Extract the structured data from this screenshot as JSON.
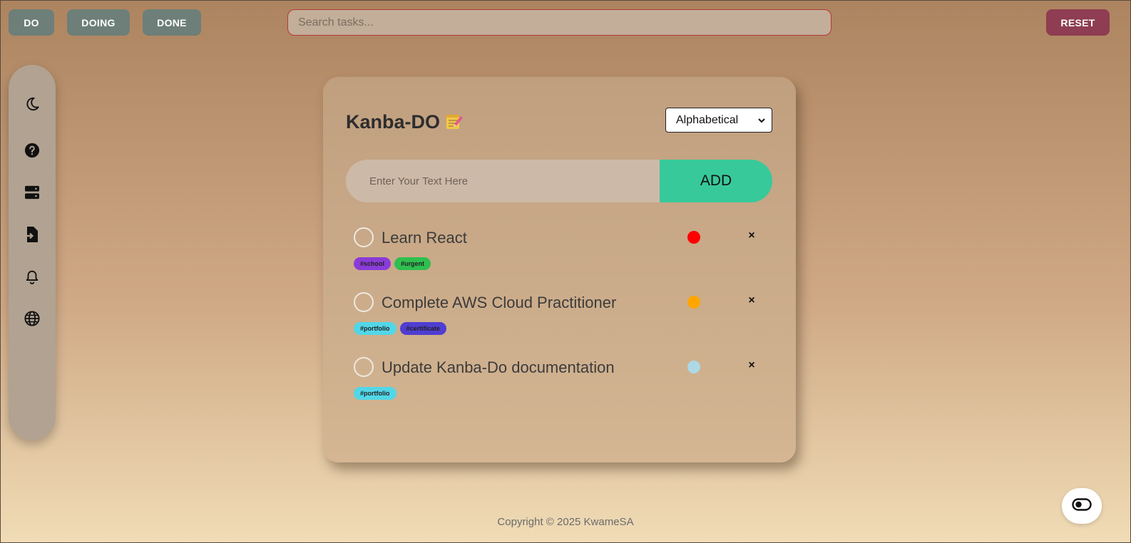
{
  "nav": {
    "do_label": "DO",
    "doing_label": "DOING",
    "done_label": "DONE",
    "reset_label": "RESET"
  },
  "search": {
    "placeholder": "Search tasks..."
  },
  "sidebar": {
    "icons": [
      "moon-icon",
      "help-icon",
      "server-icon",
      "import-icon",
      "bell-icon",
      "globe-icon"
    ]
  },
  "card": {
    "title": "Kanba-DO",
    "sort": {
      "selected": "Alphabetical"
    },
    "entry": {
      "placeholder": "Enter Your Text Here",
      "add_label": "ADD"
    },
    "tasks": [
      {
        "text": "Learn React",
        "priority_color": "#ff0000",
        "delete_label": "×",
        "tags": [
          {
            "label": "#school",
            "color": "#8a3bd8"
          },
          {
            "label": "#urgent",
            "color": "#2fbf4f"
          }
        ]
      },
      {
        "text": "Complete AWS Cloud Practitioner",
        "priority_color": "#ffa500",
        "delete_label": "×",
        "tags": [
          {
            "label": "#portfolio",
            "color": "#52d7e8"
          },
          {
            "label": "#certificate",
            "color": "#4f3ed1"
          }
        ]
      },
      {
        "text": "Update Kanba-Do documentation",
        "priority_color": "#add8e6",
        "delete_label": "×",
        "tags": [
          {
            "label": "#portfolio",
            "color": "#52d7e8"
          }
        ]
      }
    ]
  },
  "footer": {
    "text": "Copyright © 2025 KwameSA"
  },
  "colors": {
    "nav_button": "#6d7f78",
    "reset_button": "#8e3d52",
    "add_button": "#38c99a"
  }
}
